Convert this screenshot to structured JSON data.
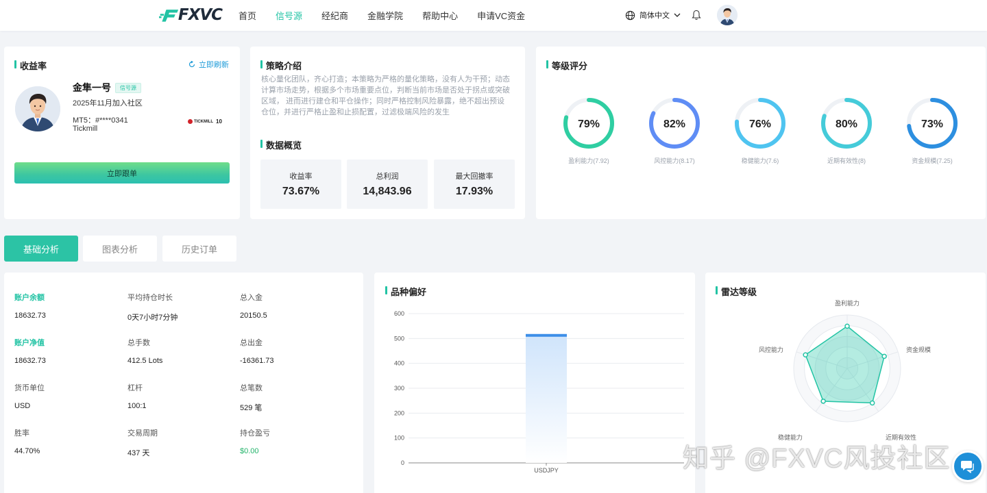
{
  "header": {
    "logo_text": "FXVC",
    "nav": [
      "首页",
      "信号源",
      "经纪商",
      "金融学院",
      "帮助中心",
      "申请VC资金"
    ],
    "active_nav": 1,
    "language": "简体中文"
  },
  "profile": {
    "title": "收益率",
    "refresh_label": "立即刷新",
    "name": "金隼一号",
    "badge": "信号源",
    "joined": "2025年11月加入社区",
    "mt5": "MT5：#****0341",
    "broker": "Tickmill",
    "broker_logo_text": "TICKMILL",
    "broker_logo_badge": "10",
    "follow_label": "立即跟单"
  },
  "strategy": {
    "title": "策略介绍",
    "description": "核心量化团队，齐心打造；本策略为严格的量化策略，没有人为干预；动态计算市场走势，根据多个市场重要点位，判断当前市场是否处于拐点或突破区域， 进而进行建仓和平仓操作；同时严格控制风险暴露，绝不超出预设仓位，并进行严格止盈和止损配置，过滤极端风险的发生",
    "overview_title": "数据概览",
    "stats": [
      {
        "label": "收益率",
        "value": "73.67%"
      },
      {
        "label": "总利润",
        "value": "14,843.96"
      },
      {
        "label": "最大回撤率",
        "value": "17.93%"
      }
    ]
  },
  "grades": {
    "title": "等级评分",
    "items": [
      {
        "percent": "79%",
        "value": 0.79,
        "label": "盈利能力(7.92)",
        "color": "#2fcea2"
      },
      {
        "percent": "82%",
        "value": 0.82,
        "label": "风控能力(8.17)",
        "color": "#5f8df5"
      },
      {
        "percent": "76%",
        "value": 0.76,
        "label": "稳健能力(7.6)",
        "color": "#4fc4f0"
      },
      {
        "percent": "80%",
        "value": 0.8,
        "label": "近期有效性(8)",
        "color": "#45cbd9"
      },
      {
        "percent": "73%",
        "value": 0.73,
        "label": "资金规模(7.25)",
        "color": "#2d8fe0"
      }
    ]
  },
  "tabs": [
    "基础分析",
    "图表分析",
    "历史订单"
  ],
  "account": {
    "cells": [
      {
        "label": "账户余额",
        "value": "18632.73",
        "accent": true
      },
      {
        "label": "平均持仓时长",
        "value": "0天7小时7分钟"
      },
      {
        "label": "总入金",
        "value": "20150.5"
      },
      {
        "label": "账户净值",
        "value": "18632.73",
        "accent": true
      },
      {
        "label": "总手数",
        "value": "412.5 Lots"
      },
      {
        "label": "总出金",
        "value": "-16361.73"
      },
      {
        "label": "货币单位",
        "value": "USD"
      },
      {
        "label": "杠杆",
        "value": "100:1"
      },
      {
        "label": "总笔数",
        "value": "529 笔"
      },
      {
        "label": "胜率",
        "value": "44.70%"
      },
      {
        "label": "交易周期",
        "value": "437 天"
      },
      {
        "label": "持仓盈亏",
        "value": "$0.00",
        "green": true
      }
    ]
  },
  "product_chart": {
    "title": "品种偏好"
  },
  "radar": {
    "title": "雷达等级",
    "axes": [
      "盈利能力",
      "资金规模",
      "近期有效性",
      "稳健能力",
      "风控能力"
    ],
    "values": [
      0.79,
      0.73,
      0.8,
      0.76,
      0.82
    ]
  },
  "chart_data": {
    "type": "bar",
    "categories": [
      "USDJPY"
    ],
    "values": [
      518
    ],
    "ylim": [
      0,
      600
    ],
    "yticks": [
      0,
      100,
      200,
      300,
      400,
      500,
      600
    ],
    "grid": true
  },
  "watermark": "知乎 @FXVC风投社区"
}
